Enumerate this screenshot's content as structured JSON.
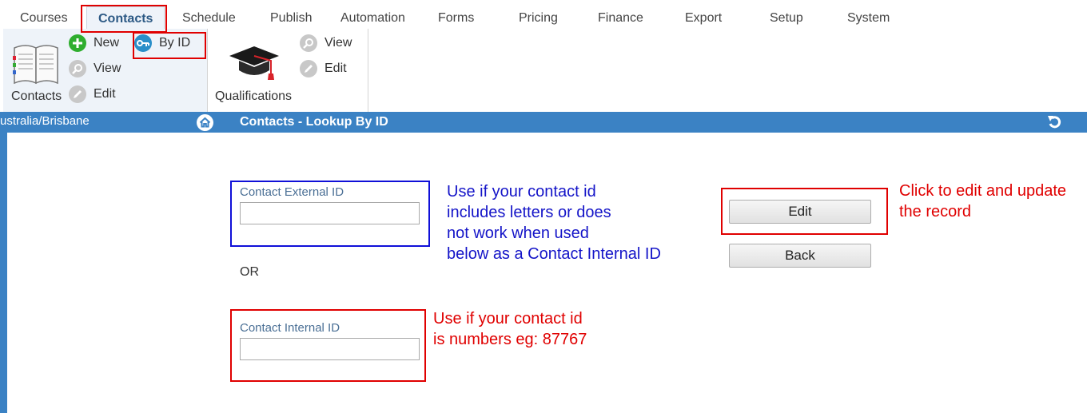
{
  "tabs": [
    {
      "label": "Courses"
    },
    {
      "label": "Contacts"
    },
    {
      "label": "Schedule"
    },
    {
      "label": "Publish"
    },
    {
      "label": "Automation"
    },
    {
      "label": "Forms"
    },
    {
      "label": "Pricing"
    },
    {
      "label": "Finance"
    },
    {
      "label": "Export"
    },
    {
      "label": "Setup"
    },
    {
      "label": "System"
    }
  ],
  "active_tab": "Contacts",
  "ribbon": {
    "contacts_group": {
      "label": "Contacts",
      "icon": "book-icon",
      "items": [
        {
          "label": "New",
          "icon": "plus-icon"
        },
        {
          "label": "By ID",
          "icon": "key-icon"
        },
        {
          "label": "View",
          "icon": "magnifier-icon"
        },
        {
          "label": "Edit",
          "icon": "pencil-icon"
        }
      ]
    },
    "qualifications_group": {
      "label": "Qualifications",
      "icon": "graduation-cap-icon",
      "items": [
        {
          "label": "View",
          "icon": "magnifier-icon"
        },
        {
          "label": "Edit",
          "icon": "pencil-icon"
        }
      ]
    }
  },
  "titlebar": {
    "timezone": "ustralia/Brisbane",
    "title": "Contacts - Lookup By ID",
    "home_icon": "home-icon",
    "refresh_icon": "refresh-icon"
  },
  "form": {
    "external_id": {
      "label": "Contact External ID",
      "value": ""
    },
    "or_label": "OR",
    "internal_id": {
      "label": "Contact Internal ID",
      "value": ""
    },
    "edit_button": "Edit",
    "back_button": "Back"
  },
  "annotations": {
    "external_note": "Use if your contact id\nincludes letters or does\nnot work when used\nbelow as a Contact Internal ID",
    "internal_note": "Use if your contact id\nis numbers eg: 87767",
    "edit_note": "Click to edit and update\nthe record"
  },
  "colors": {
    "accent_blue": "#3b82c4",
    "annotation_red": "#e00000",
    "annotation_blue": "#1414c8",
    "label_blue": "#4a6f95"
  }
}
